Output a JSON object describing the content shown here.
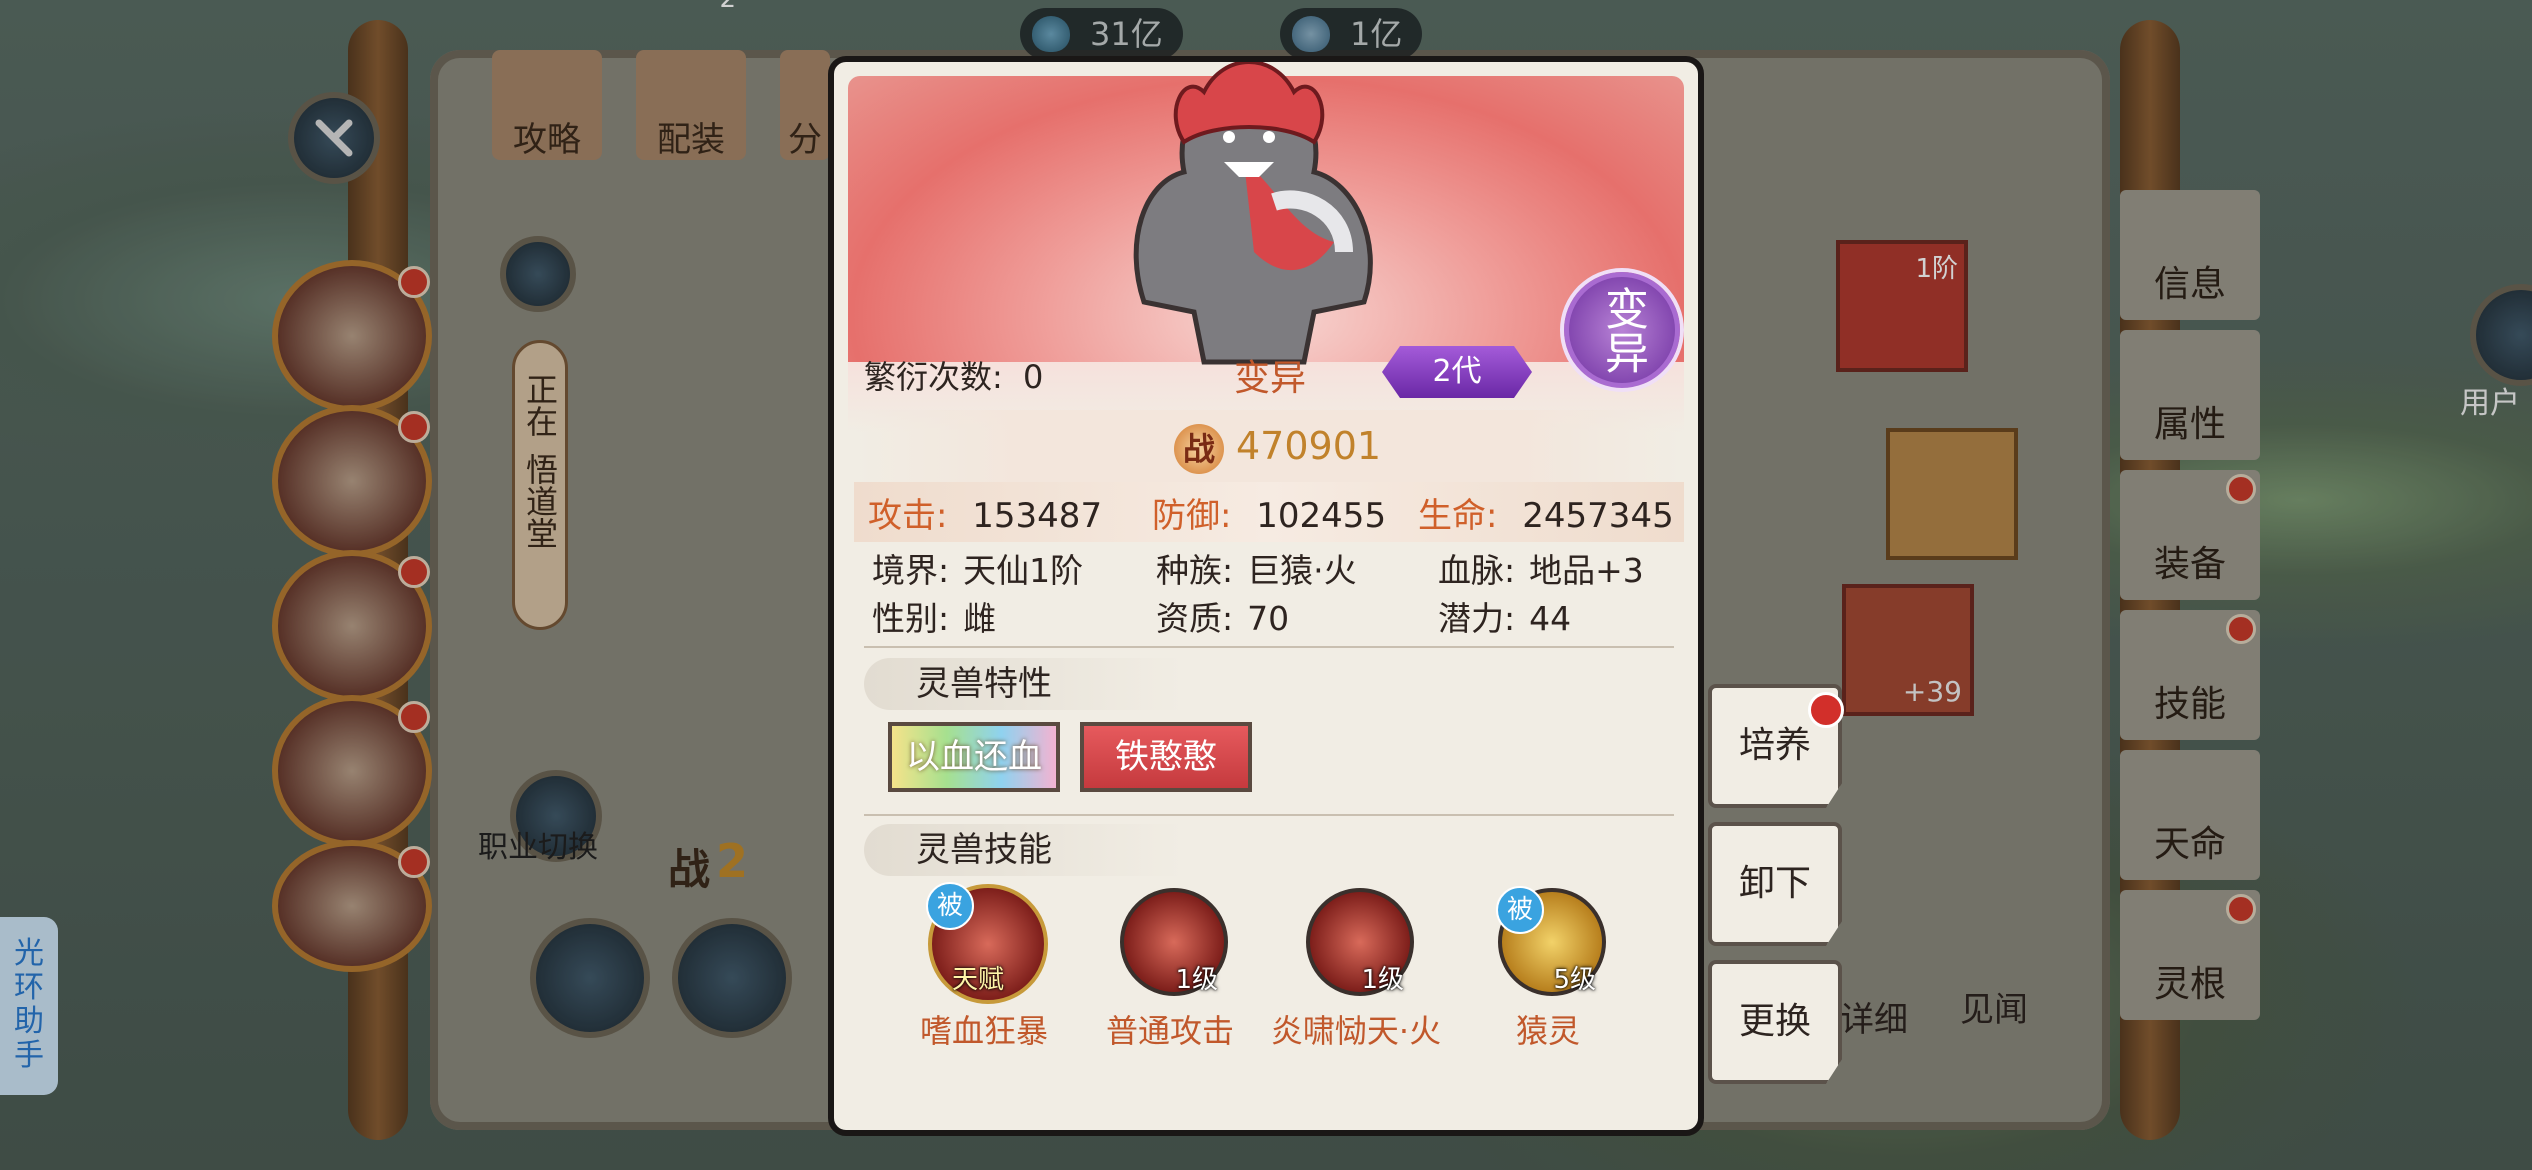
{
  "currency": [
    {
      "icon": "spirit-stone-icon",
      "value": "31亿"
    },
    {
      "icon": "crystal-icon",
      "value": "1亿"
    }
  ],
  "left_tabs": [
    "攻略",
    "配装",
    "分"
  ],
  "left_tab_badge": "2",
  "left_status_lines": [
    "正在",
    "悟道堂"
  ],
  "job_switch_label": "职业切换",
  "battle_char": "战",
  "battle_partial": "2",
  "helper_label": "光环助手",
  "right_tabs": [
    "信息",
    "属性",
    "装备",
    "技能",
    "天命",
    "灵根"
  ],
  "user_label": "用户",
  "bg_right_tier": "1阶",
  "bg_right_plus": "+39",
  "bg_right_labels": [
    "详细",
    "见闻"
  ],
  "dialog": {
    "breed_label": "繁衍次数:",
    "breed_value": "0",
    "mutation_title": "变异",
    "generation": "2代",
    "mutation_seal": "变异",
    "power_char": "战",
    "power": "470901",
    "stats": {
      "attack_label": "攻击:",
      "attack": "153487",
      "defense_label": "防御:",
      "defense": "102455",
      "hp_label": "生命:",
      "hp": "2457345"
    },
    "info": {
      "realm_label": "境界:",
      "realm": "天仙1阶",
      "race_label": "种族:",
      "race": "巨猿·火",
      "bloodline_label": "血脉:",
      "bloodline": "地品+3",
      "gender_label": "性别:",
      "gender": "雌",
      "aptitude_label": "资质:",
      "aptitude": "70",
      "potential_label": "潜力:",
      "potential": "44"
    },
    "traits_title": "灵兽特性",
    "traits": [
      "以血还血",
      "铁憨憨"
    ],
    "skills_title": "灵兽技能",
    "skills": [
      {
        "name": "嗜血狂暴",
        "badge": "被",
        "level": "天赋"
      },
      {
        "name": "普通攻击",
        "badge": "",
        "level": "1级"
      },
      {
        "name": "炎啸恸天·火",
        "badge": "",
        "level": "1级"
      },
      {
        "name": "猿灵",
        "badge": "被",
        "level": "5级"
      }
    ]
  },
  "actions": [
    "培养",
    "卸下",
    "更换"
  ],
  "colors": {
    "accent_orange": "#d0602a",
    "purple": "#7a35b0",
    "notice_red": "#d22f2a"
  }
}
